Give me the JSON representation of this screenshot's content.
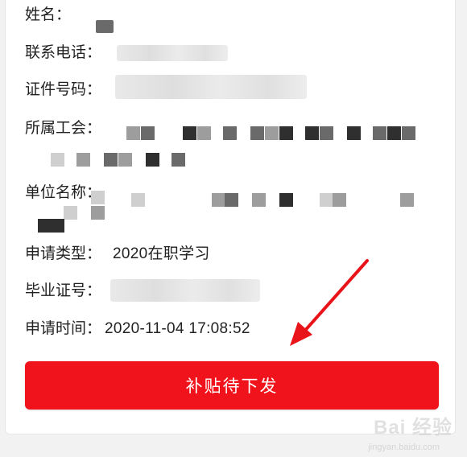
{
  "fields": {
    "name_label": "姓名：",
    "phone_label": "联系电话：",
    "id_label": "证件号码：",
    "union_label": "所属工会：",
    "employer_label": "单位名称：",
    "type_label": "申请类型：",
    "type_value": "2020在职学习",
    "cert_label": "毕业证号：",
    "time_label": "申请时间：",
    "time_value": "2020-11-04 17:08:52"
  },
  "action": {
    "status_button_label": "补贴待下发"
  },
  "colors": {
    "accent_red": "#f0131b",
    "annotation_red": "#e8141a"
  },
  "watermark": {
    "brand": "Bai 经验",
    "url": "jingyan.baidu.com"
  }
}
